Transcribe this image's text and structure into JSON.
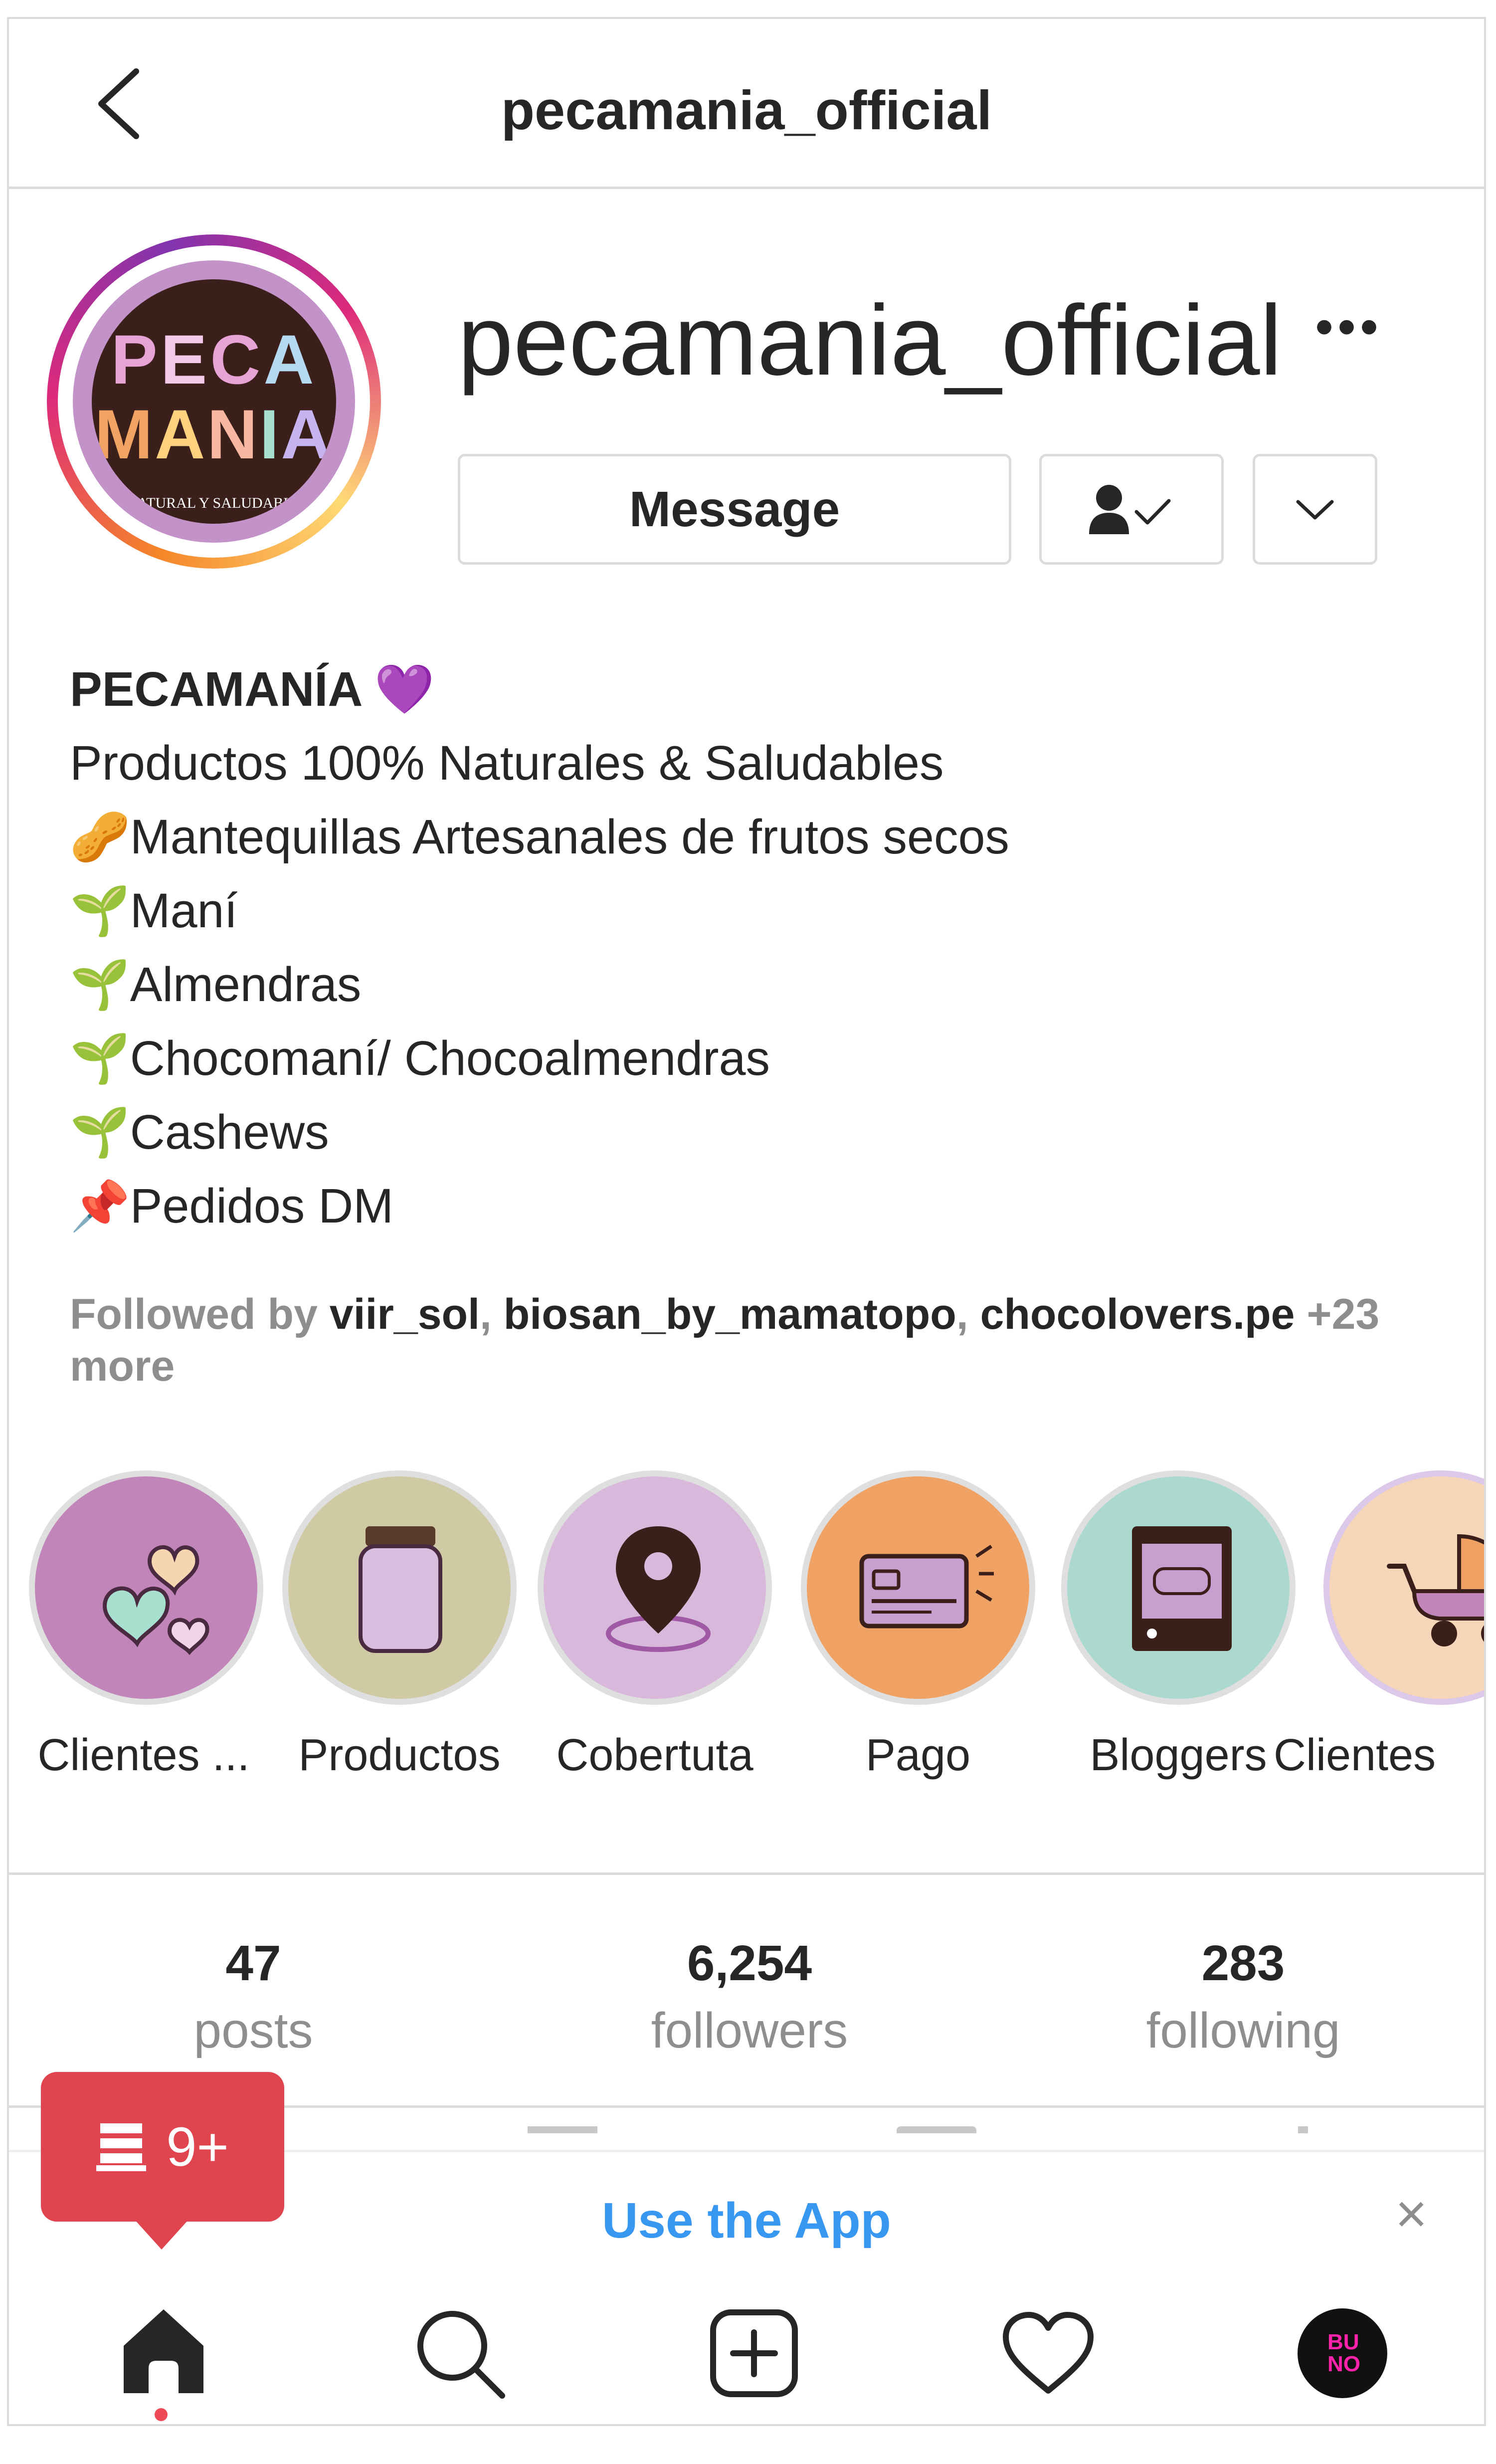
{
  "header": {
    "title": "pecamania_official"
  },
  "profile": {
    "username": "pecamania_official",
    "avatar_text": {
      "line1": "PECA",
      "line2": "MANIA",
      "tagline": "NATURAL Y SALUDABLE"
    },
    "message_button": "Message",
    "more_label": "•••"
  },
  "bio": {
    "name": "PECAMANÍA 💜",
    "lines": [
      "Productos 100% Naturales & Saludables",
      "🥜Mantequillas Artesanales de frutos secos",
      "🌱Maní",
      "🌱Almendras",
      "🌱Chocomaní/ Chocoalmendras",
      "🌱Cashews",
      "📌Pedidos DM"
    ]
  },
  "followed_by": {
    "prefix": "Followed by ",
    "accounts": [
      "viir_sol",
      "biosan_by_mamatopo",
      "chocolovers.pe"
    ],
    "suffix": "+23 more"
  },
  "highlights": [
    {
      "label": "Clientes ...",
      "icon": "hearts-icon",
      "color": "#c285b9"
    },
    {
      "label": "Productos",
      "icon": "jar-icon",
      "color": "#cfcaa4"
    },
    {
      "label": "Cobertuta",
      "icon": "location-pin-icon",
      "color": "#d8b9dc"
    },
    {
      "label": "Pago",
      "icon": "credit-card-icon",
      "color": "#f0a265"
    },
    {
      "label": "Bloggers",
      "icon": "phone-post-icon",
      "color": "#abd9cf"
    },
    {
      "label": "Clientes",
      "icon": "stroller-icon",
      "color": "#f6d6b8"
    }
  ],
  "stats": [
    {
      "value": "47",
      "label": "posts"
    },
    {
      "value": "6,254",
      "label": "followers"
    },
    {
      "value": "283",
      "label": "following"
    }
  ],
  "notification": {
    "count": "9+"
  },
  "app_banner": {
    "text": "Use the App",
    "close": "×"
  },
  "nav": {
    "items": [
      "home-icon",
      "search-icon",
      "new-post-icon",
      "activity-heart-icon",
      "profile-avatar-icon"
    ],
    "avatar_text": "BU NO"
  },
  "colors": {
    "link_blue": "#3897f0",
    "badge_red": "#e0454f",
    "border": "#dbdbdb",
    "muted": "#8e8e8e"
  }
}
